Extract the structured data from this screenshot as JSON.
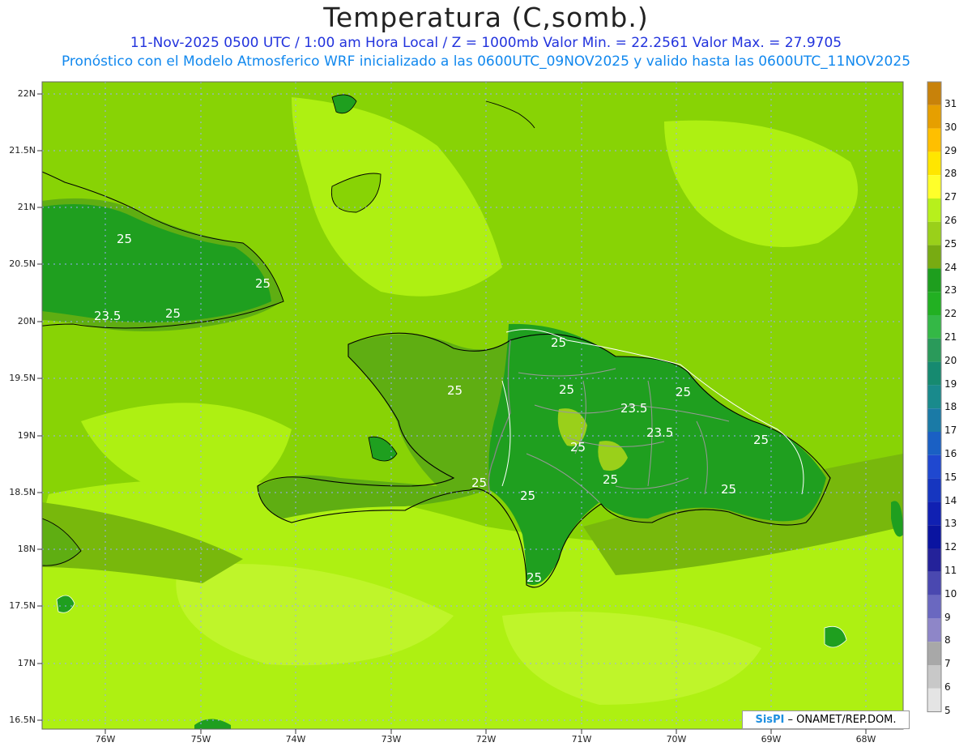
{
  "header": {
    "title": "Temperatura (C,somb.)",
    "line1": "11-Nov-2025  0500 UTC / 1:00 am Hora Local / Z = 1000mb   Valor Min. = 22.2561  Valor Max. = 27.9705",
    "line2": "Pronóstico con el Modelo Atmosferico WRF inicializado a las 0600UTC_09NOV2025 y valido hasta las  0600UTC_11NOV2025"
  },
  "axes": {
    "lat_labels": [
      "22N",
      "21.5N",
      "21N",
      "20.5N",
      "20N",
      "19.5N",
      "19N",
      "18.5N",
      "18N",
      "17.5N",
      "17N",
      "16.5N"
    ],
    "lon_labels": [
      "76W",
      "75W",
      "74W",
      "73W",
      "72W",
      "71W",
      "70W",
      "69W",
      "68W"
    ]
  },
  "contour_labels": [
    "25",
    "25",
    "23.5",
    "25",
    "25",
    "25",
    "25",
    "25",
    "23.5",
    "23.5",
    "25",
    "25",
    "25",
    "25",
    "25",
    "25"
  ],
  "colorbar": {
    "labels": [
      "31",
      "30",
      "29",
      "28",
      "27",
      "26",
      "25",
      "24",
      "23",
      "22",
      "21",
      "20",
      "19",
      "18",
      "17",
      "16",
      "15",
      "14",
      "13",
      "12",
      "11",
      "10",
      "9",
      "8",
      "7",
      "6",
      "5"
    ],
    "colors": [
      "#c8820a",
      "#e69f00",
      "#ffbf00",
      "#ffe600",
      "#ffff2a",
      "#b7f01c",
      "#9ad01a",
      "#78ab12",
      "#1e9e1e",
      "#22b022",
      "#34b846",
      "#2a9a5a",
      "#168a70",
      "#198a8c",
      "#1a7aa6",
      "#1a60c4",
      "#1f48d0",
      "#1636c0",
      "#1020b2",
      "#0a14a0",
      "#24229a",
      "#4a48b0",
      "#6a68c0",
      "#8e86c8",
      "#a8a8a8",
      "#c8c8c8",
      "#e4e4e4"
    ]
  },
  "credit": {
    "sis": "SisPI",
    "rest": "– ONAMET/REP.DOM."
  },
  "colors": {
    "sea_base": "#88d305",
    "sea_light": "#aef012",
    "sea_yellow": "#bff52a",
    "land_dark": "#5fae12",
    "land_green": "#1f9f1f"
  }
}
